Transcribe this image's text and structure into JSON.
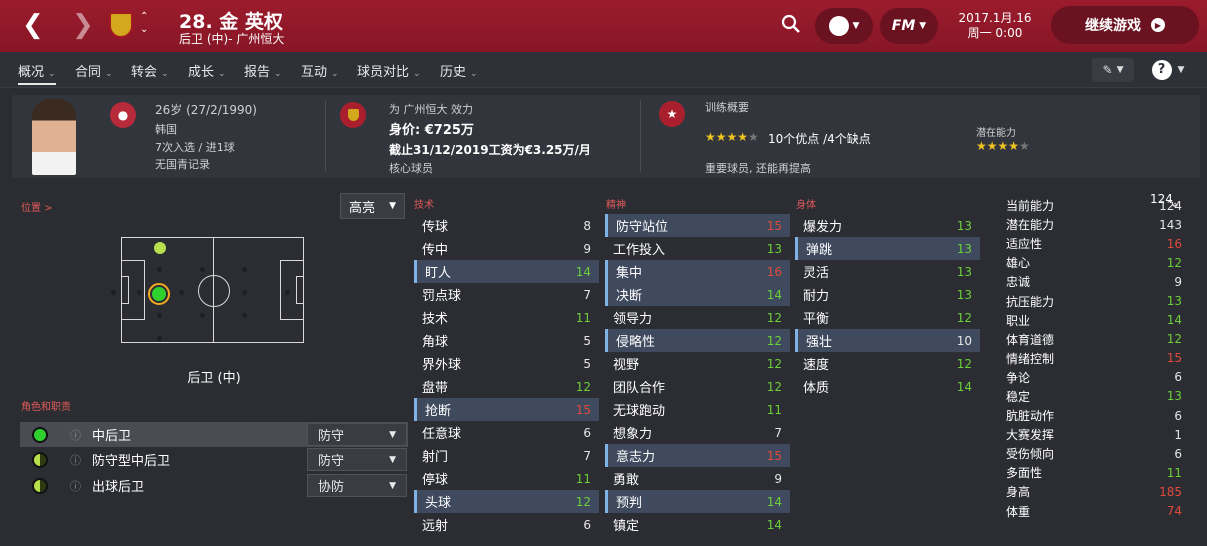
{
  "header": {
    "title": "28. 金 英权",
    "subtitle": "后卫 (中)- 广州恒大",
    "date_line1": "2017.1月.16",
    "date_line2": "周一 0:00",
    "continue_label": "继续游戏",
    "fm_label": "FM"
  },
  "tabs": [
    {
      "label": "概况",
      "active": true
    },
    {
      "label": "合同"
    },
    {
      "label": "转会"
    },
    {
      "label": "成长"
    },
    {
      "label": "报告"
    },
    {
      "label": "互动"
    },
    {
      "label": "球员对比"
    },
    {
      "label": "历史"
    }
  ],
  "info": {
    "age": "26岁 (27/2/1990)",
    "nation": "韩国",
    "caps": "7次入选 / 进1球",
    "youth": "无国青记录",
    "club_line": "为 广州恒大 效力",
    "value": "身价: €725万",
    "contract": "截止31/12/2019工资为€3.25万/月",
    "status": "核心球员",
    "training_title": "训练概要",
    "training_summary": "10个优点 /4个缺点",
    "training_note": "重要球员, 还能再提高",
    "potential_label": "潜在能力",
    "training_stars": 4,
    "potential_stars": 4
  },
  "position": {
    "label": "位置 >",
    "highlight": "高亮",
    "name": "后卫 (中)"
  },
  "roles": {
    "label": "角色和职责",
    "items": [
      {
        "name": "中后卫",
        "duty": "防守",
        "selected": true
      },
      {
        "name": "防守型中后卫",
        "duty": "防守"
      },
      {
        "name": "出球后卫",
        "duty": "协防"
      }
    ]
  },
  "technical": {
    "label": "技术",
    "attrs": [
      {
        "name": "传球",
        "value": "8",
        "color": "white"
      },
      {
        "name": "传中",
        "value": "9",
        "color": "white"
      },
      {
        "name": "盯人",
        "value": "14",
        "color": "green",
        "hl": true
      },
      {
        "name": "罚点球",
        "value": "7",
        "color": "white"
      },
      {
        "name": "技术",
        "value": "11",
        "color": "green"
      },
      {
        "name": "角球",
        "value": "5",
        "color": "white"
      },
      {
        "name": "界外球",
        "value": "5",
        "color": "white"
      },
      {
        "name": "盘带",
        "value": "12",
        "color": "green"
      },
      {
        "name": "抢断",
        "value": "15",
        "color": "red",
        "hl": true
      },
      {
        "name": "任意球",
        "value": "6",
        "color": "white"
      },
      {
        "name": "射门",
        "value": "7",
        "color": "white"
      },
      {
        "name": "停球",
        "value": "11",
        "color": "green"
      },
      {
        "name": "头球",
        "value": "12",
        "color": "green",
        "hl": true
      },
      {
        "name": "远射",
        "value": "6",
        "color": "white"
      }
    ]
  },
  "mental": {
    "label": "精神",
    "attrs": [
      {
        "name": "防守站位",
        "value": "15",
        "color": "red",
        "hl": true
      },
      {
        "name": "工作投入",
        "value": "13",
        "color": "green"
      },
      {
        "name": "集中",
        "value": "16",
        "color": "red",
        "hl": true
      },
      {
        "name": "决断",
        "value": "14",
        "color": "green",
        "hl": true
      },
      {
        "name": "领导力",
        "value": "12",
        "color": "green"
      },
      {
        "name": "侵略性",
        "value": "12",
        "color": "green",
        "hl": true
      },
      {
        "name": "视野",
        "value": "12",
        "color": "green"
      },
      {
        "name": "团队合作",
        "value": "12",
        "color": "green"
      },
      {
        "name": "无球跑动",
        "value": "11",
        "color": "green"
      },
      {
        "name": "想象力",
        "value": "7",
        "color": "white"
      },
      {
        "name": "意志力",
        "value": "15",
        "color": "red",
        "hl": true
      },
      {
        "name": "勇敢",
        "value": "9",
        "color": "white"
      },
      {
        "name": "预判",
        "value": "14",
        "color": "green",
        "hl": true
      },
      {
        "name": "镇定",
        "value": "14",
        "color": "green"
      }
    ]
  },
  "physical": {
    "label": "身体",
    "attrs": [
      {
        "name": "爆发力",
        "value": "13",
        "color": "green"
      },
      {
        "name": "弹跳",
        "value": "13",
        "color": "green",
        "hl": true
      },
      {
        "name": "灵活",
        "value": "13",
        "color": "green"
      },
      {
        "name": "耐力",
        "value": "13",
        "color": "green"
      },
      {
        "name": "平衡",
        "value": "12",
        "color": "green"
      },
      {
        "name": "强壮",
        "value": "10",
        "color": "white",
        "hl": true
      },
      {
        "name": "速度",
        "value": "12",
        "color": "green"
      },
      {
        "name": "体质",
        "value": "14",
        "color": "green"
      }
    ]
  },
  "stats": {
    "top_value": "124",
    "rows": [
      {
        "name": "当前能力",
        "value": "124",
        "color": "white"
      },
      {
        "name": "潜在能力",
        "value": "143",
        "color": "white"
      },
      {
        "name": "适应性",
        "value": "16",
        "color": "red"
      },
      {
        "name": "雄心",
        "value": "12",
        "color": "green"
      },
      {
        "name": "忠诚",
        "value": "9",
        "color": "white"
      },
      {
        "name": "抗压能力",
        "value": "13",
        "color": "green"
      },
      {
        "name": "职业",
        "value": "14",
        "color": "green"
      },
      {
        "name": "体育道德",
        "value": "12",
        "color": "green"
      },
      {
        "name": "情绪控制",
        "value": "15",
        "color": "red"
      },
      {
        "name": "争论",
        "value": "6",
        "color": "white"
      },
      {
        "name": "稳定",
        "value": "13",
        "color": "green"
      },
      {
        "name": "肮脏动作",
        "value": "6",
        "color": "white"
      },
      {
        "name": "大赛发挥",
        "value": "1",
        "color": "white"
      },
      {
        "name": "受伤倾向",
        "value": "6",
        "color": "white"
      },
      {
        "name": "多面性",
        "value": "11",
        "color": "green"
      },
      {
        "name": "身高",
        "value": "185",
        "color": "red"
      },
      {
        "name": "体重",
        "value": "74",
        "color": "red"
      }
    ]
  }
}
